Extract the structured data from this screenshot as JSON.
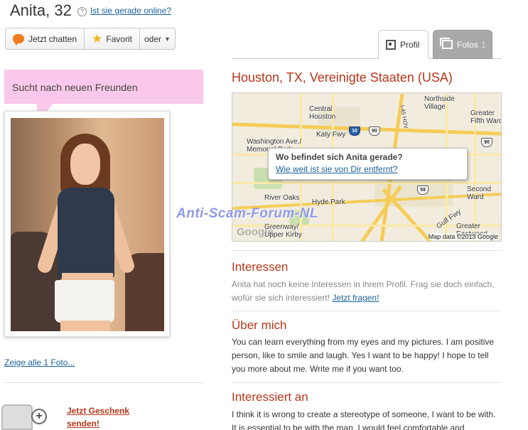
{
  "profile": {
    "name_age": "Anita, 32",
    "help_glyph": "?",
    "online_link": "Ist sie gerade online?"
  },
  "actions": {
    "chat_label": "Jetzt chatten",
    "favorite_label": "Favorit",
    "more_label": "oder"
  },
  "tabs": {
    "profil_label": "Profil",
    "fotos_label": "Fotos",
    "fotos_count": "1"
  },
  "status_bubble": "Sucht nach neuen Freunden",
  "photos": {
    "show_all_link": "Zeige alle 1 Foto..."
  },
  "gift": {
    "link_line1": "Jetzt Geschenk",
    "link_line2": "senden!"
  },
  "location": {
    "title": "Houston, TX, Vereinigte Staaten (USA)",
    "map": {
      "labels": {
        "northside": "Northside\nVillage",
        "central_houston": "Central\nHouston",
        "greater_fifth_ward": "Greater\nFifth Ward",
        "katy_fwy": "Katy Fwy",
        "washington_ave": "Washington Ave./\nMemorial Park",
        "river_oaks": "River Oaks",
        "hyde_park": "Hyde Park",
        "second_ward": "Second\nWard",
        "greenway": "Greenway/\nUpper Kirby",
        "gulf_fwy": "Gulf Fwy",
        "greater_eastwood": "Greater\nEastwood",
        "hov": "I-45 HOV"
      },
      "shields": {
        "i10": "10",
        "us90a": "90",
        "us90b": "90",
        "us59": "59"
      },
      "credit": "Map data ©2013 Google",
      "google_logo": "Google",
      "popup_question": "Wo befindet sich Anita gerade?",
      "popup_link": "Wie weit ist sie von Dir entfernt?"
    }
  },
  "watermark": "Anti-Scam-Forum-NL",
  "interests": {
    "title": "Interessen",
    "text": "Anita hat noch keine Interessen in ihrem Profil. Frag sie doch einfach, wofür sie sich interessiert!",
    "link": "Jetzt fragen!"
  },
  "about": {
    "title": "Über mich",
    "text": "You can learn everything from my eyes and my pictures. I am positive person, like to smile and laugh. Yes I want to be happy! I hope to tell you more about me. Write me if you want too."
  },
  "interested_in": {
    "title": "Interessiert an",
    "text": "I think it is wrong to create a stereotype of someone, I want to be with. It is essential to be with the man, I would feel comfortable and"
  },
  "colors": {
    "accent": "#b8361a",
    "link": "#1a5f9a",
    "bubble": "#f9c8ea"
  }
}
